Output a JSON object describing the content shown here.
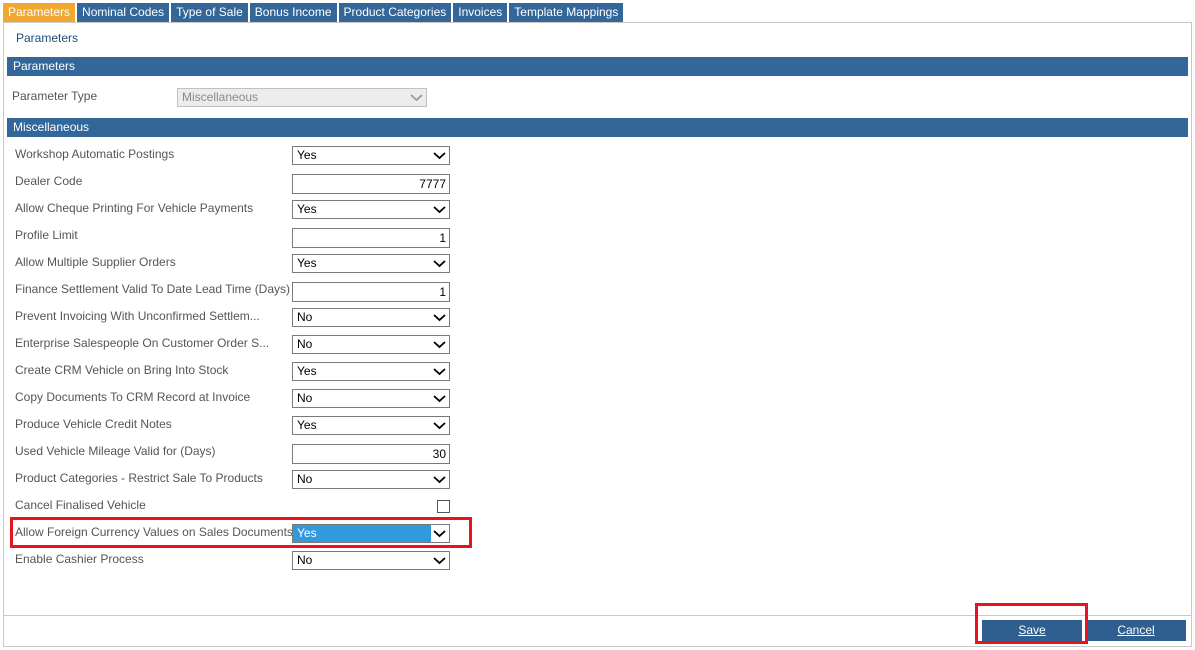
{
  "tabs": [
    {
      "label": "Parameters",
      "active": true
    },
    {
      "label": "Nominal Codes"
    },
    {
      "label": "Type of Sale"
    },
    {
      "label": "Bonus Income"
    },
    {
      "label": "Product Categories"
    },
    {
      "label": "Invoices"
    },
    {
      "label": "Template Mappings"
    }
  ],
  "page_title": "Parameters",
  "parameters_section": {
    "header": "Parameters",
    "parameter_type_label": "Parameter Type",
    "parameter_type_value": "Miscellaneous"
  },
  "misc_section": {
    "header": "Miscellaneous",
    "fields": [
      {
        "label": "Workshop Automatic Postings",
        "type": "select",
        "value": "Yes"
      },
      {
        "label": "Dealer Code",
        "type": "text",
        "value": "7777"
      },
      {
        "label": "Allow Cheque Printing For Vehicle Payments",
        "type": "select",
        "value": "Yes"
      },
      {
        "label": "Profile Limit",
        "type": "text",
        "value": "1"
      },
      {
        "label": "Allow Multiple Supplier Orders",
        "type": "select",
        "value": "Yes"
      },
      {
        "label": "Finance Settlement Valid To Date Lead Time (Days)",
        "type": "text",
        "value": "1"
      },
      {
        "label": "Prevent Invoicing With Unconfirmed Settlem...",
        "type": "select",
        "value": "No"
      },
      {
        "label": "Enterprise Salespeople On Customer Order S...",
        "type": "select",
        "value": "No"
      },
      {
        "label": "Create CRM Vehicle on Bring Into Stock",
        "type": "select",
        "value": "Yes"
      },
      {
        "label": "Copy Documents To CRM Record at Invoice",
        "type": "select",
        "value": "No"
      },
      {
        "label": "Produce Vehicle Credit Notes",
        "type": "select",
        "value": "Yes"
      },
      {
        "label": "Used Vehicle Mileage Valid for (Days)",
        "type": "text",
        "value": "30"
      },
      {
        "label": "Product Categories - Restrict Sale To Products",
        "type": "select",
        "value": "No"
      },
      {
        "label": "Cancel Finalised Vehicle",
        "type": "checkbox",
        "checked": false
      },
      {
        "label": "Allow Foreign Currency Values on Sales Documents",
        "type": "select",
        "value": "Yes",
        "highlighted": true
      },
      {
        "label": "Enable Cashier Process",
        "type": "select",
        "value": "No"
      }
    ]
  },
  "buttons": {
    "save": "Save",
    "cancel": "Cancel"
  },
  "colors": {
    "header_bar": "#336699",
    "active_tab": "#f0a830",
    "highlight_box": "#e8141b",
    "selected_option": "#3399dd"
  }
}
